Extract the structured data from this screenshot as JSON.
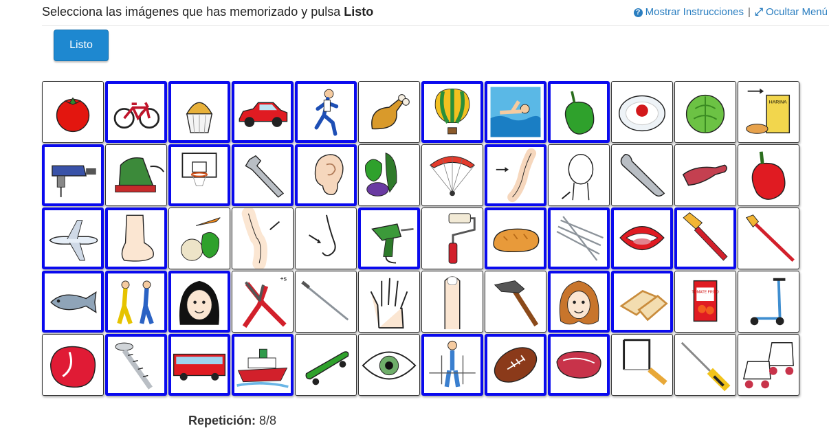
{
  "header": {
    "title_prefix": "Selecciona las imágenes que has memorizado y pulsa ",
    "title_bold": "Listo",
    "show_instructions": "Mostrar Instrucciones",
    "separator": "|",
    "hide_menu": "Ocultar Menú"
  },
  "listo_button": "Listo",
  "footer": {
    "label": "Repetición:",
    "value": "8/8"
  },
  "colors": {
    "selected_border": "#0a0aee",
    "button_bg": "#1e88d0",
    "link": "#2a7ec0"
  },
  "grid": {
    "rows": 5,
    "cols": 12,
    "cells": [
      {
        "icon": "tomato",
        "selected": false
      },
      {
        "icon": "bicycle",
        "selected": true
      },
      {
        "icon": "muffin",
        "selected": true
      },
      {
        "icon": "car",
        "selected": true
      },
      {
        "icon": "runner",
        "selected": true
      },
      {
        "icon": "chicken-leg",
        "selected": false
      },
      {
        "icon": "hot-air-balloon",
        "selected": true
      },
      {
        "icon": "swimmer",
        "selected": true
      },
      {
        "icon": "green-pepper",
        "selected": true
      },
      {
        "icon": "rice-plate",
        "selected": false
      },
      {
        "icon": "lettuce",
        "selected": false
      },
      {
        "icon": "flour",
        "selected": false
      },
      {
        "icon": "jigsaw",
        "selected": true
      },
      {
        "icon": "sander",
        "selected": false
      },
      {
        "icon": "basketball-hoop",
        "selected": true
      },
      {
        "icon": "adjustable-wrench",
        "selected": true
      },
      {
        "icon": "ear",
        "selected": true
      },
      {
        "icon": "vegetables",
        "selected": false
      },
      {
        "icon": "paraglider",
        "selected": false
      },
      {
        "icon": "arm",
        "selected": true
      },
      {
        "icon": "neck",
        "selected": false
      },
      {
        "icon": "wrench",
        "selected": false
      },
      {
        "icon": "meat-piece",
        "selected": false
      },
      {
        "icon": "red-pepper",
        "selected": false
      },
      {
        "icon": "airplane",
        "selected": true
      },
      {
        "icon": "foot",
        "selected": true
      },
      {
        "icon": "onion-carrot-pepper",
        "selected": false
      },
      {
        "icon": "knee",
        "selected": false
      },
      {
        "icon": "nose",
        "selected": false
      },
      {
        "icon": "drill",
        "selected": true
      },
      {
        "icon": "paint-roller",
        "selected": false
      },
      {
        "icon": "bread",
        "selected": true
      },
      {
        "icon": "nails",
        "selected": true
      },
      {
        "icon": "mouth",
        "selected": true
      },
      {
        "icon": "paintbrush",
        "selected": true
      },
      {
        "icon": "artist-brush",
        "selected": false
      },
      {
        "icon": "fish",
        "selected": true
      },
      {
        "icon": "handball",
        "selected": true
      },
      {
        "icon": "girl-face",
        "selected": true
      },
      {
        "icon": "pliers",
        "selected": false
      },
      {
        "icon": "nail",
        "selected": false
      },
      {
        "icon": "hand",
        "selected": false
      },
      {
        "icon": "finger",
        "selected": false
      },
      {
        "icon": "hammer",
        "selected": false
      },
      {
        "icon": "hair",
        "selected": true
      },
      {
        "icon": "sliced-bread",
        "selected": true
      },
      {
        "icon": "tomato-frito",
        "selected": false
      },
      {
        "icon": "scooter",
        "selected": false
      },
      {
        "icon": "raw-meat",
        "selected": false
      },
      {
        "icon": "screw",
        "selected": true
      },
      {
        "icon": "bus",
        "selected": true
      },
      {
        "icon": "ship",
        "selected": true
      },
      {
        "icon": "skateboard",
        "selected": false
      },
      {
        "icon": "eye",
        "selected": false
      },
      {
        "icon": "skier",
        "selected": true
      },
      {
        "icon": "rugby-ball",
        "selected": true
      },
      {
        "icon": "steak",
        "selected": true
      },
      {
        "icon": "coping-saw",
        "selected": false
      },
      {
        "icon": "screwdriver",
        "selected": false
      },
      {
        "icon": "roller-skates",
        "selected": false
      }
    ]
  },
  "labels": {
    "flour_text": "HARINA",
    "tomato_frito_text": "TOMATE FRITO",
    "pliers_plural": "+s"
  }
}
